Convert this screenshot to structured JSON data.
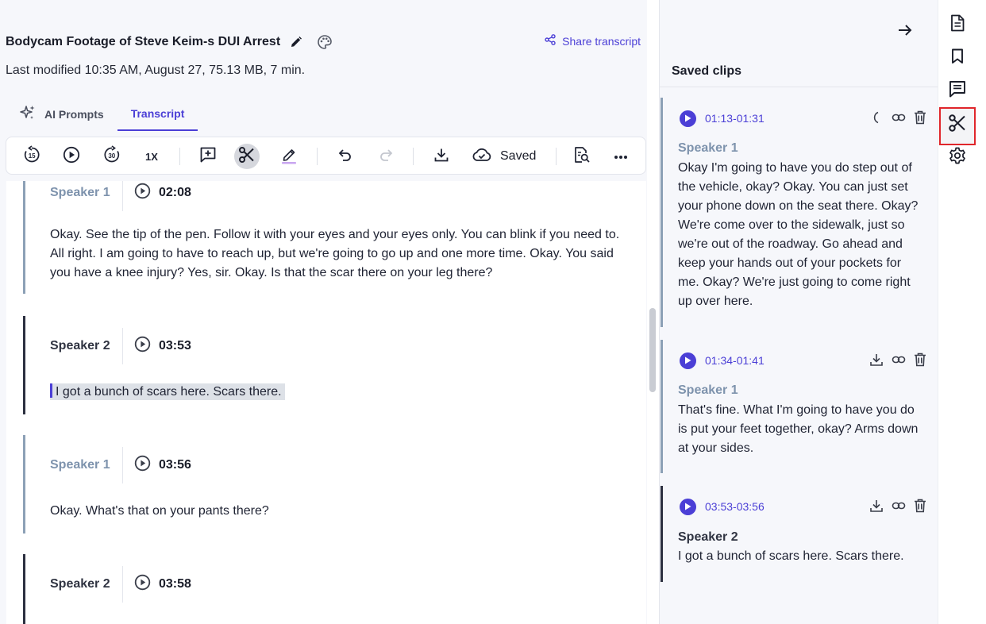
{
  "header": {
    "title": "Bodycam Footage of Steve Keim-s DUI Arrest",
    "share_label": "Share transcript",
    "meta": "Last modified 10:35 AM, August 27, 75.13 MB, 7 min."
  },
  "tabs": [
    {
      "label": "AI Prompts",
      "icon": "sparkle-icon"
    },
    {
      "label": "Transcript",
      "active": true
    }
  ],
  "toolbar": {
    "speed": "1X",
    "saved_label": "Saved",
    "icons": [
      "rewind-15-icon",
      "play-icon",
      "forward-30-icon",
      "speed-button",
      "add-comment-icon",
      "scissors-icon",
      "highlighter-icon",
      "undo-icon",
      "redo-icon",
      "download-icon",
      "cloud-check-icon",
      "search-document-icon",
      "more-icon"
    ]
  },
  "segments": [
    {
      "speaker": "Speaker 1",
      "time": "02:08",
      "text": "Okay. See the tip of the pen. Follow it with your eyes and your eyes only. You can blink if you need to. All right. I am going to have to reach up, but we're going to go up and one more time. Okay. You said you have a knee injury? Yes, sir. Okay. Is that the scar there on your leg there?"
    },
    {
      "speaker": "Speaker 2",
      "time": "03:53",
      "text": "I got a bunch of scars here. Scars there."
    },
    {
      "speaker": "Speaker 1",
      "time": "03:56",
      "text": "Okay. What's that on your pants there?"
    },
    {
      "speaker": "Speaker 2",
      "time": "03:58",
      "text": ""
    }
  ],
  "clips_panel": {
    "title": "Saved clips",
    "clips": [
      {
        "range": "01:13-01:31",
        "speaker": "Speaker 1",
        "text": "Okay I'm going to have you do step out of the vehicle, okay? Okay. You can just set your phone down on the seat there. Okay? We're come over to the sidewalk, just so we're out of the roadway. Go ahead and keep your hands out of your pockets for me. Okay? We're just going to come right up over here.",
        "first_action": "loading-spinner-icon"
      },
      {
        "range": "01:34-01:41",
        "speaker": "Speaker 1",
        "text": "That's fine. What I'm going to have you do is put your feet together, okay? Arms down at your sides.",
        "first_action": "download-icon"
      },
      {
        "range": "03:53-03:56",
        "speaker": "Speaker 2",
        "text": "I got a bunch of scars here. Scars there.",
        "first_action": "download-icon"
      }
    ]
  },
  "rail": {
    "items": [
      "document-icon",
      "bookmark-icon",
      "comments-icon",
      "scissors-icon",
      "settings-gear-icon"
    ],
    "active": "scissors-icon"
  },
  "colors": {
    "accent": "#4b3fd6",
    "speaker1_border": "#8ca0b6",
    "speaker2_border": "#2c3040",
    "highlight_box": "#e0262b"
  }
}
